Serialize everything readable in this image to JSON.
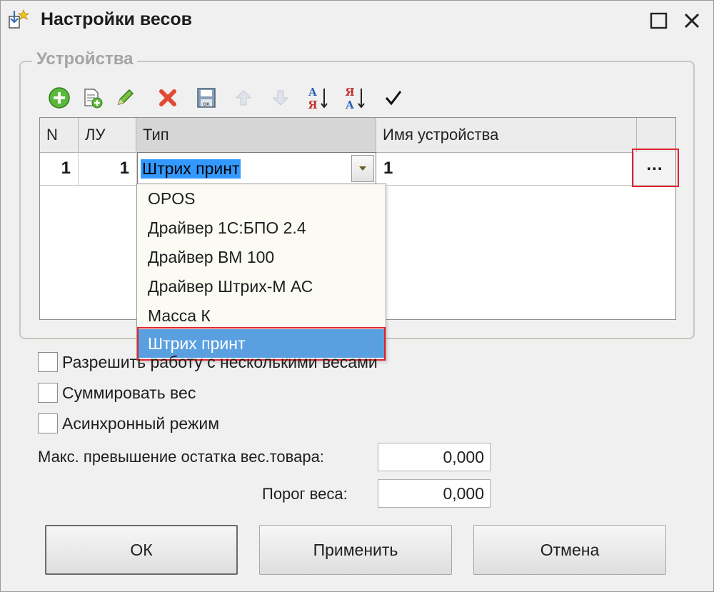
{
  "window": {
    "title": "Настройки весов"
  },
  "group": {
    "legend": "Устройства"
  },
  "toolbar": {
    "icons": [
      "add-icon",
      "copy-icon",
      "edit-icon",
      "delete-icon",
      "save-icon",
      "move-up-icon",
      "move-down-icon",
      "sort-asc-icon",
      "sort-desc-icon",
      "check-icon"
    ]
  },
  "grid": {
    "columns": [
      "N",
      "ЛУ",
      "Тип",
      "Имя устройства"
    ],
    "rows": [
      {
        "n": "1",
        "lu": "1",
        "type": "Штрих принт",
        "name": "1",
        "dots": "..."
      }
    ]
  },
  "dropdown": {
    "options": [
      "OPOS",
      "Драйвер 1С:БПО 2.4",
      "Драйвер ВМ 100",
      "Драйвер Штрих-М АС",
      "Масса К",
      "Штрих принт"
    ],
    "selected": "Штрих принт"
  },
  "options": {
    "multi_scales": "Разрешить работу с несколькими весами",
    "sum_weight": "Суммировать вес",
    "async_mode": "Асинхронный режим"
  },
  "fields": {
    "max_excess_label": "Макс. превышение остатка вес.товара:",
    "max_excess_value": "0,000",
    "threshold_label": "Порог веса:",
    "threshold_value": "0,000"
  },
  "buttons": {
    "ok": "ОК",
    "apply": "Применить",
    "cancel": "Отмена"
  },
  "colors": {
    "highlight": "#e3232c",
    "selection": "#5aa0e0"
  }
}
